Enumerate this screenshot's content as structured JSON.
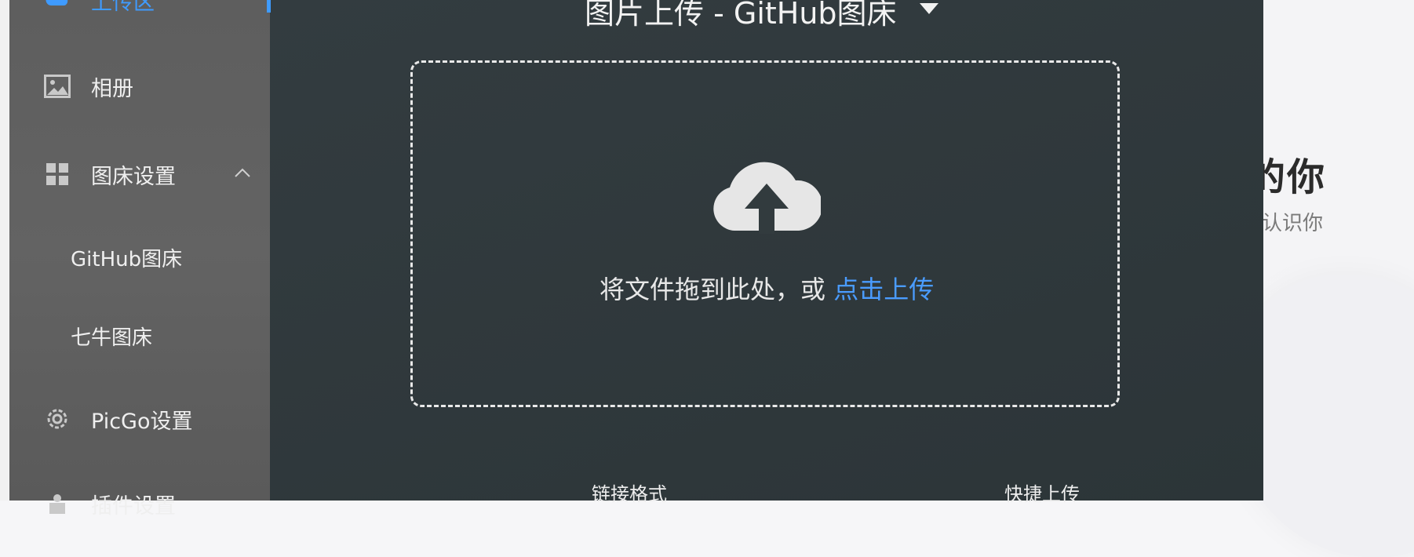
{
  "window": {
    "title": "图片上传 - GitHub图床"
  },
  "sidebar": {
    "items": [
      {
        "label": "上传区",
        "icon": "upload-icon",
        "active": true
      },
      {
        "label": "相册",
        "icon": "image-icon"
      },
      {
        "label": "图床设置",
        "icon": "grid-icon",
        "expanded": true
      },
      {
        "label": "PicGo设置",
        "icon": "gear-icon"
      },
      {
        "label": "插件设置",
        "icon": "plugin-icon"
      }
    ],
    "subitems": [
      {
        "label": "GitHub图床"
      },
      {
        "label": "七牛图床"
      }
    ]
  },
  "upload": {
    "drop_text": "将文件拖到此处，或",
    "drop_link": "点击上传",
    "icon": "cloud-upload-icon"
  },
  "footer": {
    "link_format_label": "链接格式",
    "quick_upload_label": "快捷上传"
  },
  "background": {
    "heading": "的你",
    "subheading": "认识你"
  },
  "colors": {
    "accent": "#4a9cff",
    "sidebar_bg": "#606060",
    "main_bg": "#30393c"
  }
}
